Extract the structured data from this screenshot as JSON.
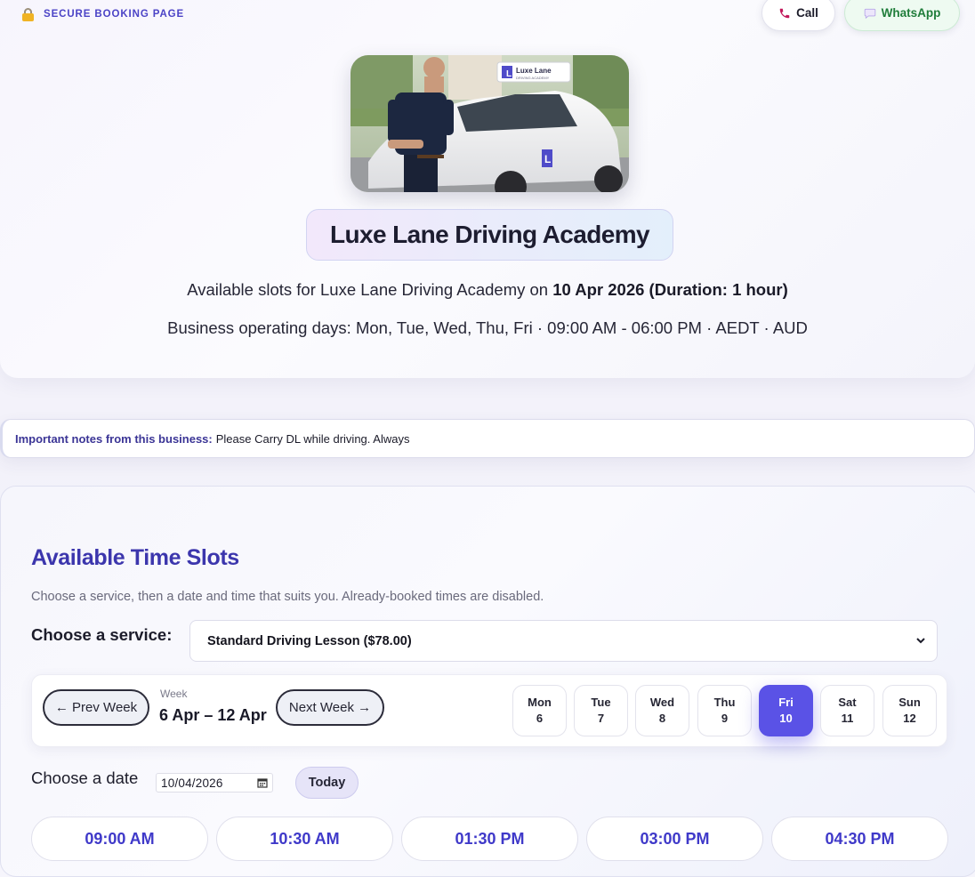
{
  "header": {
    "secure_label": "SECURE BOOKING PAGE",
    "call_label": "Call",
    "whatsapp_label": "WhatsApp"
  },
  "business": {
    "name": "Luxe Lane Driving Academy",
    "avail_prefix": "Available slots for Luxe Lane Driving Academy on",
    "avail_bold": "10 Apr 2026 (Duration: 1 hour)",
    "operating": "Business operating days: Mon, Tue, Wed, Thu, Fri · 09:00 AM - 06:00 PM · AEDT · AUD",
    "car_sign_brand": "Luxe Lane",
    "car_sign_sub": "DRIVING ACADEMY"
  },
  "notes": {
    "label": "Important notes from this business:",
    "text": "Please Carry DL while driving. Always"
  },
  "slots": {
    "title": "Available Time Slots",
    "subtitle": "Choose a service, then a date and time that suits you. Already-booked times are disabled.",
    "service_label": "Choose a service:",
    "service_selected": "Standard Driving Lesson ($78.00)",
    "prev_week": "← Prev Week",
    "next_week": "Next Week →",
    "week_label": "Week",
    "week_range": "6 Apr – 12 Apr",
    "days": [
      {
        "name": "Mon",
        "num": "6"
      },
      {
        "name": "Tue",
        "num": "7"
      },
      {
        "name": "Wed",
        "num": "8"
      },
      {
        "name": "Thu",
        "num": "9"
      },
      {
        "name": "Fri",
        "num": "10",
        "selected": true
      },
      {
        "name": "Sat",
        "num": "11"
      },
      {
        "name": "Sun",
        "num": "12"
      }
    ],
    "date_label": "Choose a date",
    "date_value": "10/04/2026",
    "today_label": "Today",
    "times": [
      "09:00 AM",
      "10:30 AM",
      "01:30 PM",
      "03:00 PM",
      "04:30 PM"
    ]
  },
  "colors": {
    "accent": "#5a52e6",
    "title": "#3c36ad",
    "whatsapp": "#1f7d3a"
  }
}
